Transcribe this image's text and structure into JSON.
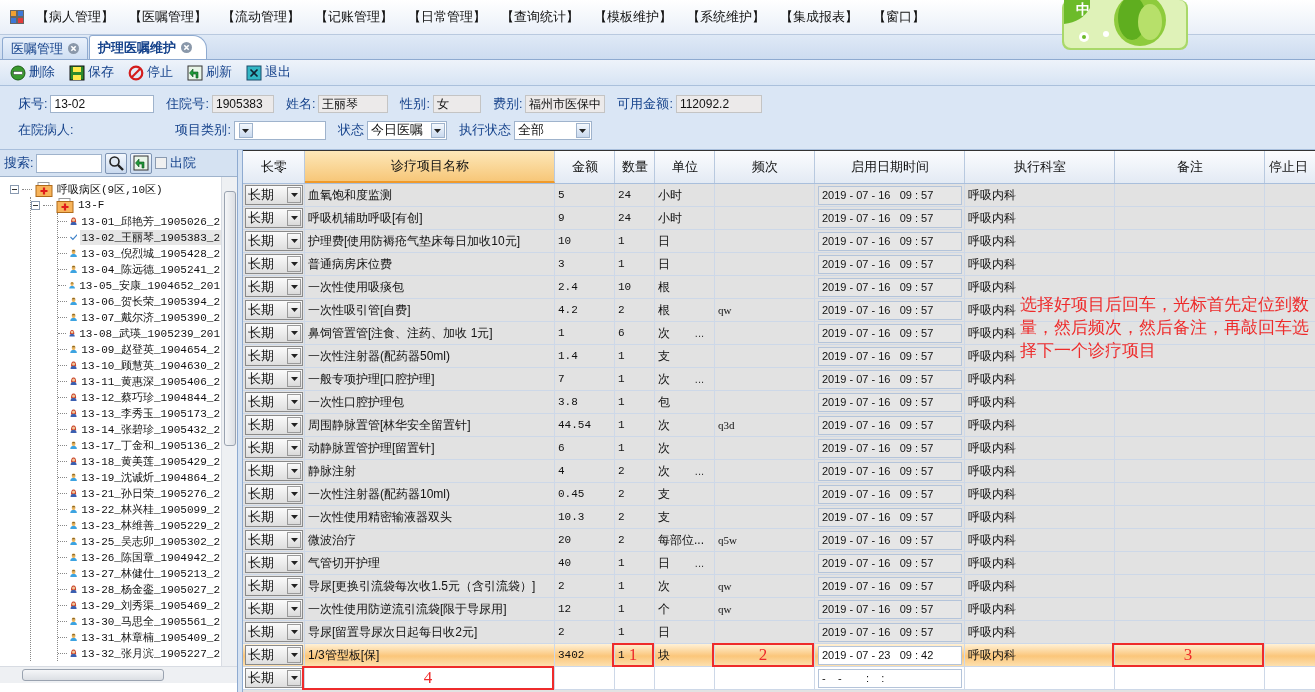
{
  "menu": [
    {
      "label": "【病人管理】"
    },
    {
      "label": "【医嘱管理】"
    },
    {
      "label": "【流动管理】"
    },
    {
      "label": "【记账管理】"
    },
    {
      "label": "【日常管理】"
    },
    {
      "label": "【查询统计】"
    },
    {
      "label": "【模板维护】"
    },
    {
      "label": "【系统维护】"
    },
    {
      "label": "【集成报表】"
    },
    {
      "label": "【窗口】"
    }
  ],
  "logo": {
    "glyph": "中"
  },
  "tabs": [
    {
      "label": "医嘱管理",
      "selected": false
    },
    {
      "label": "护理医嘱维护",
      "selected": true
    }
  ],
  "toolbar": [
    {
      "label": "删除",
      "kind": "delete"
    },
    {
      "label": "保存",
      "kind": "save"
    },
    {
      "label": "停止",
      "kind": "stop"
    },
    {
      "label": "刷新",
      "kind": "refresh"
    },
    {
      "label": "退出",
      "kind": "exit"
    }
  ],
  "form": {
    "row1": [
      {
        "label": "床号:",
        "value": "13-02",
        "kind": "text",
        "readonly": false
      },
      {
        "label": "住院号:",
        "value": "1905383",
        "kind": "text",
        "readonly": true
      },
      {
        "label": "姓名:",
        "value": "王丽琴",
        "kind": "text",
        "readonly": true
      },
      {
        "label": "性别:",
        "value": "女",
        "kind": "text",
        "readonly": true
      },
      {
        "label": "费别:",
        "value": "福州市医保中",
        "kind": "text",
        "readonly": true
      },
      {
        "label": "可用金额:",
        "value": "112092.2",
        "kind": "text",
        "readonly": true
      }
    ],
    "row2": [
      {
        "label": "在院病人:",
        "kind": "label"
      },
      {
        "label": "项目类别:",
        "kind": "select"
      },
      {
        "label": "状态",
        "value": "今日医嘱",
        "kind": "select"
      },
      {
        "label": "执行状态",
        "value": "全部",
        "kind": "select"
      }
    ]
  },
  "sidebar": {
    "search_label": "搜索:",
    "discharged": {
      "label": "出院",
      "checked": false
    },
    "tree": [
      {
        "label": "呼吸病区(9区,10区)",
        "kind": "ward",
        "expanded": true,
        "children": [
          {
            "label": "13-F",
            "kind": "ward",
            "expanded": true,
            "children": [
              {
                "label": "13-01_邱艳芳_1905026_2",
                "kind": "female",
                "selected": false
              },
              {
                "label": "13-02_王丽琴_1905383_2",
                "kind": "female",
                "selected": true
              },
              {
                "label": "13-03_倪烈城_1905428_2",
                "kind": "male",
                "selected": false
              },
              {
                "label": "13-04_陈远德_1905241_2",
                "kind": "male",
                "selected": false
              },
              {
                "label": "13-05_安康_1904652_201",
                "kind": "male",
                "selected": false
              },
              {
                "label": "13-06_贺长荣_1905394_2",
                "kind": "male",
                "selected": false
              },
              {
                "label": "13-07_戴尔济_1905390_2",
                "kind": "male",
                "selected": false
              },
              {
                "label": "13-08_武瑛_1905239_201",
                "kind": "female",
                "selected": false
              },
              {
                "label": "13-09_赵登英_1904654_2",
                "kind": "male",
                "selected": false
              },
              {
                "label": "13-10_顾慧英_1904630_2",
                "kind": "female",
                "selected": false
              },
              {
                "label": "13-11_黄惠深_1905406_2",
                "kind": "female",
                "selected": false
              },
              {
                "label": "13-12_蔡巧珍_1904844_2",
                "kind": "female",
                "selected": false
              },
              {
                "label": "13-13_李秀玉_1905173_2",
                "kind": "female",
                "selected": false
              },
              {
                "label": "13-14_张碧珍_1905432_2",
                "kind": "female",
                "selected": false
              },
              {
                "label": "13-17_丁金和_1905136_2",
                "kind": "male",
                "selected": false
              },
              {
                "label": "13-18_黄美莲_1905429_2",
                "kind": "female",
                "selected": false
              },
              {
                "label": "13-19_沈诚炘_1904864_2",
                "kind": "male",
                "selected": false
              },
              {
                "label": "13-21_孙日荣_1905276_2",
                "kind": "female",
                "selected": false
              },
              {
                "label": "13-22_林兴桂_1905099_2",
                "kind": "male",
                "selected": false
              },
              {
                "label": "13-23_林维善_1905229_2",
                "kind": "male",
                "selected": false
              },
              {
                "label": "13-25_吴志卯_1905302_2",
                "kind": "male",
                "selected": false
              },
              {
                "label": "13-26_陈国章_1904942_2",
                "kind": "male",
                "selected": false
              },
              {
                "label": "13-27_林健仕_1905213_2",
                "kind": "male",
                "selected": false
              },
              {
                "label": "13-28_杨金銮_1905027_2",
                "kind": "female",
                "selected": false
              },
              {
                "label": "13-29_刘秀渠_1905469_2",
                "kind": "female",
                "selected": false
              },
              {
                "label": "13-30_马思全_1905561_2",
                "kind": "male",
                "selected": false
              },
              {
                "label": "13-31_林章楠_1905409_2",
                "kind": "male",
                "selected": false
              },
              {
                "label": "13-32_张月滨_1905227_2",
                "kind": "female",
                "selected": false
              }
            ]
          }
        ]
      }
    ]
  },
  "table": {
    "columns": [
      {
        "label": "长零",
        "highlighted": false
      },
      {
        "label": "诊疗项目名称",
        "highlighted": true
      },
      {
        "label": "金额",
        "highlighted": false
      },
      {
        "label": "数量",
        "highlighted": false
      },
      {
        "label": "单位",
        "highlighted": false
      },
      {
        "label": "频次",
        "highlighted": false
      },
      {
        "label": "启用日期时间",
        "highlighted": false
      },
      {
        "label": "执行科室",
        "highlighted": false
      },
      {
        "label": "备注",
        "highlighted": false
      },
      {
        "label": "停止日",
        "highlighted": false
      }
    ],
    "rows": [
      {
        "term": "长期",
        "name": "血氧饱和度监测",
        "amount": "5",
        "qty": "24",
        "unit": "小时",
        "start": "2019 - 07 - 16   09 : 57",
        "dept": "呼吸内科",
        "selected": false
      },
      {
        "term": "长期",
        "name": "呼吸机辅助呼吸[有创]",
        "amount": "9",
        "qty": "24",
        "unit": "小时",
        "start": "2019 - 07 - 16   09 : 57",
        "dept": "呼吸内科",
        "selected": false
      },
      {
        "term": "长期",
        "name": "护理费[使用防褥疮气垫床每日加收10元]",
        "amount": "10",
        "qty": "1",
        "unit": "日",
        "start": "2019 - 07 - 16   09 : 57",
        "dept": "呼吸内科",
        "selected": false
      },
      {
        "term": "长期",
        "name": "普通病房床位费",
        "amount": "3",
        "qty": "1",
        "unit": "日",
        "start": "2019 - 07 - 16   09 : 57",
        "dept": "呼吸内科",
        "selected": false
      },
      {
        "term": "长期",
        "name": "一次性使用吸痰包",
        "amount": "2.4",
        "qty": "10",
        "unit": "根",
        "start": "2019 - 07 - 16   09 : 57",
        "dept": "呼吸内科",
        "selected": false
      },
      {
        "term": "长期",
        "name": "一次性吸引管[自费]",
        "amount": "4.2",
        "qty": "2",
        "unit": "根",
        "freq": "qw",
        "start": "2019 - 07 - 16   09 : 57",
        "dept": "呼吸内科",
        "selected": false
      },
      {
        "term": "长期",
        "name": "鼻饲管置管[注食、注药、加收 1元]",
        "amount": "1",
        "qty": "6",
        "unit": "次",
        "unit_more": "...",
        "start": "2019 - 07 - 16   09 : 57",
        "dept": "呼吸内科",
        "selected": false
      },
      {
        "term": "长期",
        "name": "一次性注射器(配药器50ml)",
        "amount": "1.4",
        "qty": "1",
        "unit": "支",
        "start": "2019 - 07 - 16   09 : 57",
        "dept": "呼吸内科",
        "selected": false
      },
      {
        "term": "长期",
        "name": "一般专项护理[口腔护理]",
        "amount": "7",
        "qty": "1",
        "unit": "次",
        "unit_more": "...",
        "start": "2019 - 07 - 16   09 : 57",
        "dept": "呼吸内科",
        "selected": false
      },
      {
        "term": "长期",
        "name": "一次性口腔护理包",
        "amount": "3.8",
        "qty": "1",
        "unit": "包",
        "start": "2019 - 07 - 16   09 : 57",
        "dept": "呼吸内科",
        "selected": false
      },
      {
        "term": "长期",
        "name": "周围静脉置管[林华安全留置针]",
        "amount": "44.54",
        "qty": "1",
        "unit": "次",
        "freq": "q3d",
        "start": "2019 - 07 - 16   09 : 57",
        "dept": "呼吸内科",
        "selected": false
      },
      {
        "term": "长期",
        "name": "动静脉置管护理[留置针]",
        "amount": "6",
        "qty": "1",
        "unit": "次",
        "start": "2019 - 07 - 16   09 : 57",
        "dept": "呼吸内科",
        "selected": false
      },
      {
        "term": "长期",
        "name": "静脉注射",
        "amount": "4",
        "qty": "2",
        "unit": "次",
        "unit_more": "...",
        "start": "2019 - 07 - 16   09 : 57",
        "dept": "呼吸内科",
        "selected": false
      },
      {
        "term": "长期",
        "name": "一次性注射器(配药器10ml)",
        "amount": "0.45",
        "qty": "2",
        "unit": "支",
        "start": "2019 - 07 - 16   09 : 57",
        "dept": "呼吸内科",
        "selected": false
      },
      {
        "term": "长期",
        "name": "一次性使用精密输液器双头",
        "amount": "10.3",
        "qty": "2",
        "unit": "支",
        "start": "2019 - 07 - 16   09 : 57",
        "dept": "呼吸内科",
        "selected": false
      },
      {
        "term": "长期",
        "name": "微波治疗",
        "amount": "20",
        "qty": "2",
        "unit": "每部位...",
        "freq": "q5w",
        "start": "2019 - 07 - 16   09 : 57",
        "dept": "呼吸内科",
        "selected": false
      },
      {
        "term": "长期",
        "name": "气管切开护理",
        "amount": "40",
        "qty": "1",
        "unit": "日",
        "unit_more": "...",
        "start": "2019 - 07 - 16   09 : 57",
        "dept": "呼吸内科",
        "selected": false
      },
      {
        "term": "长期",
        "name": "导尿[更换引流袋每次收1.5元（含引流袋）]",
        "amount": "2",
        "qty": "1",
        "unit": "次",
        "freq": "qw",
        "start": "2019 - 07 - 16   09 : 57",
        "dept": "呼吸内科",
        "selected": false
      },
      {
        "term": "长期",
        "name": "一次性使用防逆流引流袋[限于导尿用]",
        "amount": "12",
        "qty": "1",
        "unit": "个",
        "freq": "qw",
        "start": "2019 - 07 - 16   09 : 57",
        "dept": "呼吸内科",
        "selected": false
      },
      {
        "term": "长期",
        "name": "导尿[留置导尿次日起每日收2元]",
        "amount": "2",
        "qty": "1",
        "unit": "日",
        "start": "2019 - 07 - 16   09 : 57",
        "dept": "呼吸内科",
        "selected": false
      },
      {
        "term": "长期",
        "name": "1/3管型板[保]",
        "amount": "3402",
        "qty": "1",
        "unit": "块",
        "start": "2019 - 07 - 23   09 : 42",
        "dept": "呼吸内科",
        "selected": true,
        "callouts": {
          "qty": "1",
          "freq": "2",
          "note": "3"
        }
      }
    ],
    "new_row": {
      "term": "长期",
      "start": "-    -        :    :",
      "callouts": {
        "name": "4"
      }
    }
  },
  "annotation": {
    "text": "选择好项目后回车，光标首先定位到数量，然后频次，然后备注，再敲回车选择下一个诊疗项目"
  }
}
